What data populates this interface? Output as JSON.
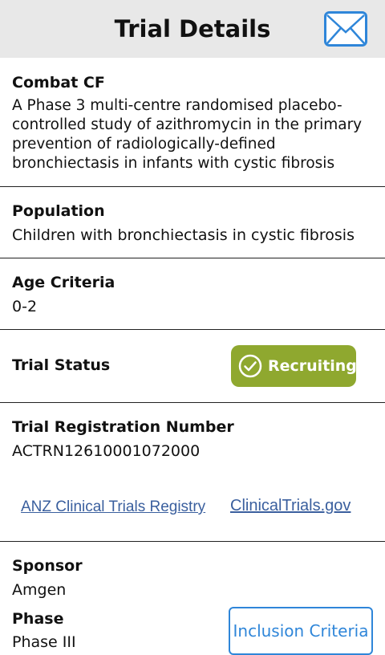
{
  "header": {
    "title": "Trial Details",
    "mail_icon": "envelope-icon"
  },
  "trial": {
    "name": "Combat CF",
    "description": "A Phase 3 multi-centre randomised placebo-controlled study of azithromycin in the primary prevention of radiologically-defined bronchiectasis in infants with cystic fibrosis"
  },
  "population": {
    "label": "Population",
    "value": "Children with bronchiectasis in cystic fibrosis"
  },
  "age": {
    "label": "Age Criteria",
    "value": "0-2"
  },
  "status": {
    "label": "Trial Status",
    "value": "Recruiting",
    "icon": "check-circle-icon",
    "color": "#8fa82f"
  },
  "registration": {
    "label": "Trial Registration Number",
    "value": "ACTRN12610001072000",
    "links": [
      "ANZ Clinical Trials Registry",
      "ClinicalTrials.gov"
    ]
  },
  "sponsor": {
    "label": "Sponsor",
    "value": "Amgen"
  },
  "phase": {
    "label": "Phase",
    "value": "Phase III"
  },
  "inclusion_button": {
    "label": "Inclusion Criteria",
    "color": "#2f86d9"
  }
}
